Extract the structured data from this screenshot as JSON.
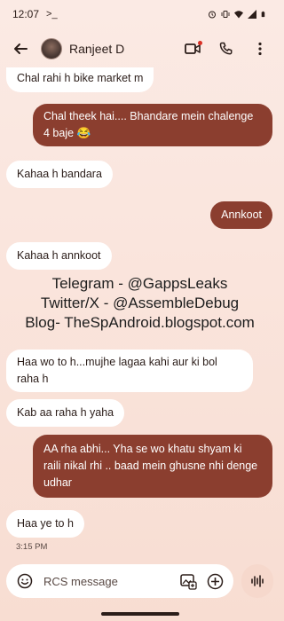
{
  "status_bar": {
    "time": "12:07",
    "prompt_glyph": ">_"
  },
  "header": {
    "contact_name": "Ranjeet D"
  },
  "messages": [
    {
      "dir": "in",
      "text": "Chal rahi h bike market m"
    },
    {
      "dir": "out",
      "text": "Chal theek hai.... Bhandare mein chalenge 4 baje 😂"
    },
    {
      "dir": "in",
      "text": "Kahaa h bandara"
    },
    {
      "dir": "out",
      "text": "Annkoot"
    },
    {
      "dir": "in",
      "text": "Kahaa h annkoot"
    },
    {
      "dir": "in",
      "text": "Haa wo to h...mujhe lagaa kahi aur ki bol raha h"
    },
    {
      "dir": "in",
      "text": "Kab aa raha h yaha"
    },
    {
      "dir": "out",
      "text": "AA rha abhi... Yha se wo khatu shyam ki raili nikal rhi .. baad mein ghusne nhi denge udhar"
    },
    {
      "dir": "in",
      "text": "Haa ye to h"
    }
  ],
  "watermark": {
    "line1": "Telegram - @GappsLeaks",
    "line2": "Twitter/X - @AssembleDebug",
    "line3": "Blog- TheSpAndroid.blogspot.com"
  },
  "timestamp": "3:15 PM",
  "composer": {
    "placeholder": "RCS message"
  },
  "icons": {
    "back": "arrow-back-icon",
    "video": "video-call-icon",
    "phone": "phone-icon",
    "more": "more-vert-icon",
    "emoji": "emoji-icon",
    "gallery": "gallery-icon",
    "add": "add-icon",
    "voice": "voice-waveform-icon"
  },
  "colors": {
    "background": "#fbeae4",
    "outgoing_bubble": "#8b3e2f",
    "incoming_bubble": "#ffffff",
    "accent_dot": "#d93025"
  }
}
